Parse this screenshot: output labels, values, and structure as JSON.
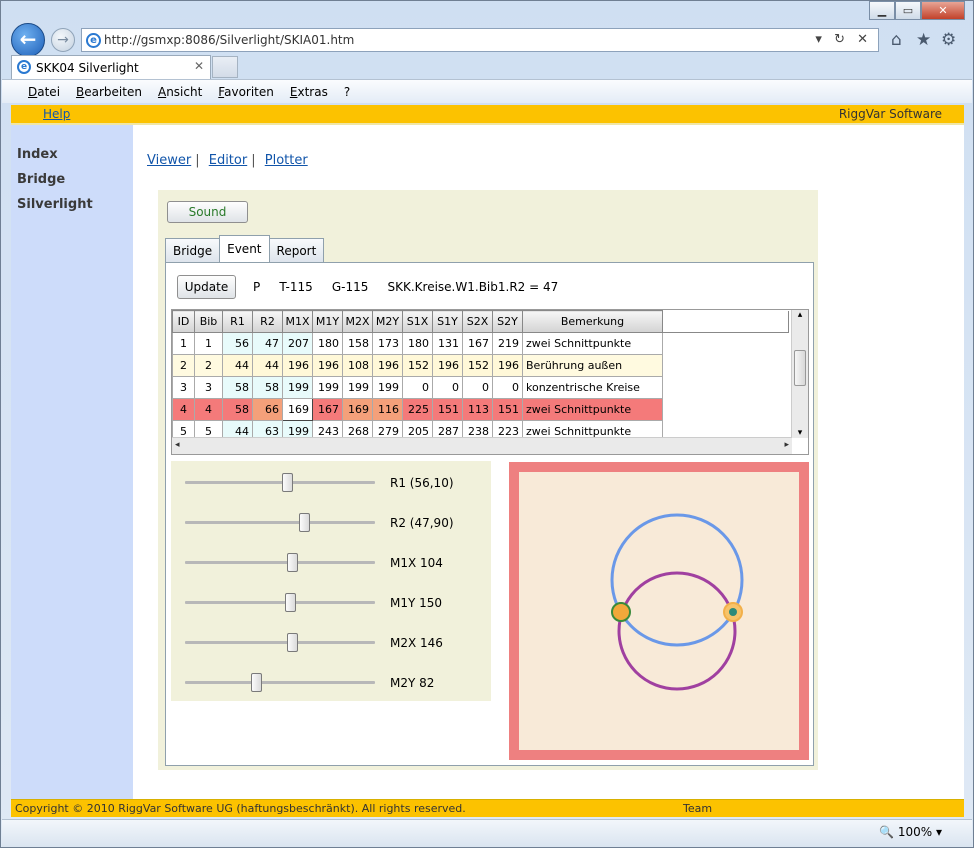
{
  "browser": {
    "url": "http://gsmxp:8086/Silverlight/SKIA01.htm",
    "tab_title": "SKK04 Silverlight",
    "tab_close": "✕",
    "win_min": "▁",
    "win_max": "▭",
    "win_close": "✕",
    "back_glyph": "←",
    "fwd_glyph": "→",
    "addr_controls": "▾ ↻ ✕",
    "home_icon": "⌂",
    "fav_icon": "★",
    "tools_icon": "⚙",
    "menu": [
      "Datei",
      "Bearbeiten",
      "Ansicht",
      "Favoriten",
      "Extras",
      "?"
    ],
    "zoom": "100%",
    "zoom_arrow": "▾"
  },
  "header": {
    "help": "Help",
    "brand": "RiggVar Software"
  },
  "sidebar": {
    "items": [
      "Index",
      "Bridge",
      "Silverlight"
    ]
  },
  "nav": {
    "viewer": "Viewer",
    "editor": "Editor",
    "plotter": "Plotter",
    "sep": "|"
  },
  "app": {
    "sound_label": "Sound",
    "tabs": [
      "Bridge",
      "Event",
      "Report"
    ],
    "update_label": "Update",
    "info": {
      "p": "P",
      "t": "T-115",
      "g": "G-115",
      "expr": "SKK.Kreise.W1.Bib1.R2 = 47"
    },
    "grid": {
      "columns": [
        "ID",
        "Bib",
        "R1",
        "R2",
        "M1X",
        "M1Y",
        "M2X",
        "M2Y",
        "S1X",
        "S1Y",
        "S2X",
        "S2Y",
        "Bemerkung"
      ],
      "rows": [
        [
          "1",
          "1",
          "56",
          "47",
          "207",
          "180",
          "158",
          "173",
          "180",
          "131",
          "167",
          "219",
          "zwei Schnittpunkte"
        ],
        [
          "2",
          "2",
          "44",
          "44",
          "196",
          "196",
          "108",
          "196",
          "152",
          "196",
          "152",
          "196",
          "Berührung außen"
        ],
        [
          "3",
          "3",
          "58",
          "58",
          "199",
          "199",
          "199",
          "199",
          "0",
          "0",
          "0",
          "0",
          "konzentrische Kreise"
        ],
        [
          "4",
          "4",
          "58",
          "66",
          "169",
          "167",
          "169",
          "116",
          "225",
          "151",
          "113",
          "151",
          "zwei Schnittpunkte"
        ],
        [
          "5",
          "5",
          "44",
          "63",
          "199",
          "243",
          "268",
          "279",
          "205",
          "287",
          "238",
          "223",
          "zwei Schnittpunkte"
        ]
      ],
      "scroll_left": "◂",
      "scroll_right": "▸",
      "scroll_up": "▴",
      "scroll_down": "▾"
    },
    "sliders": [
      {
        "label": "R1 (56,10)",
        "level": 0.54
      },
      {
        "label": "R2 (47,90)",
        "level": 0.63
      },
      {
        "label": "M1X 104",
        "level": 0.57
      },
      {
        "label": "M1Y 150",
        "level": 0.56
      },
      {
        "label": "M2X 146",
        "level": 0.57
      },
      {
        "label": "M2Y 82",
        "level": 0.38
      }
    ],
    "colors": {
      "circle1": "#6a98e8",
      "circle2": "#a040a0",
      "plot_bg": "#f8ead8",
      "plot_border": "#ee8080",
      "row_selected": "#f47a7a",
      "row_highlight": "#fffae0",
      "cell_cyan": "#e8fbfb"
    }
  },
  "footer": {
    "copyright": "Copyright © 2010 RiggVar Software UG (haftungsbeschränkt). All rights reserved.",
    "team": "Team"
  }
}
